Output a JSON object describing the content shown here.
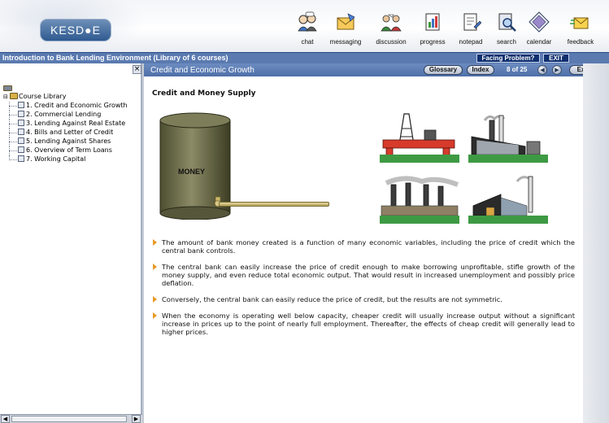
{
  "branding": {
    "logo_text": "KESD●E"
  },
  "toolbar": {
    "items": [
      {
        "label": "chat",
        "icon": "chat-icon"
      },
      {
        "label": "messaging",
        "icon": "envelope-icon"
      },
      {
        "label": "discussion",
        "icon": "discussion-icon"
      },
      {
        "label": "progress",
        "icon": "progress-icon"
      },
      {
        "label": "notepad",
        "icon": "notepad-icon"
      },
      {
        "label": "search",
        "icon": "search-icon"
      },
      {
        "label": "calendar",
        "icon": "calendar-icon"
      },
      {
        "label": "feedback",
        "icon": "feedback-icon"
      }
    ]
  },
  "course": {
    "title": "Introduction to Bank Lending Environment (Library of 6 courses)",
    "facing_problem_label": "Facing Problem?",
    "exit_label": "EXIT"
  },
  "tree": {
    "root_label": "Course Library",
    "items": [
      "1. Credit and Economic Growth",
      "2. Commercial Lending",
      "3. Lending Against Real Estate",
      "4. Bills and Letter of Credit",
      "5. Lending Against Shares",
      "6. Overview of Term Loans",
      "7. Working Capital"
    ]
  },
  "topic": {
    "title": "Credit and Economic Growth",
    "glossary_label": "Glossary",
    "index_label": "Index",
    "page_indicator": "8 of 25",
    "exit_label": "Exit"
  },
  "content": {
    "heading": "Credit and Money Supply",
    "tank_label": "MONEY",
    "bullets": [
      "The amount of bank money created is a function of many economic variables, including the price of credit which the central bank controls.",
      "The central bank can easily increase the price of credit enough to make borrowing unprofitable, stifle growth of the money supply, and even reduce total economic output. That would result in increased unemployment and possibly price deflation.",
      "Conversely, the central bank can easily reduce the price of credit, but the results are not symmetric.",
      "When the economy is operating well below capacity, cheaper credit will usually increase output without a significant increase in prices up to the point of nearly full employment. Thereafter, the effects of cheap credit will generally lead to higher prices."
    ]
  },
  "colors": {
    "header_bar": "#5a7ab0",
    "topic_bar": "#4e6fa8",
    "bullet_arrow": "#e79a26",
    "tank": "#6b6c4a"
  }
}
